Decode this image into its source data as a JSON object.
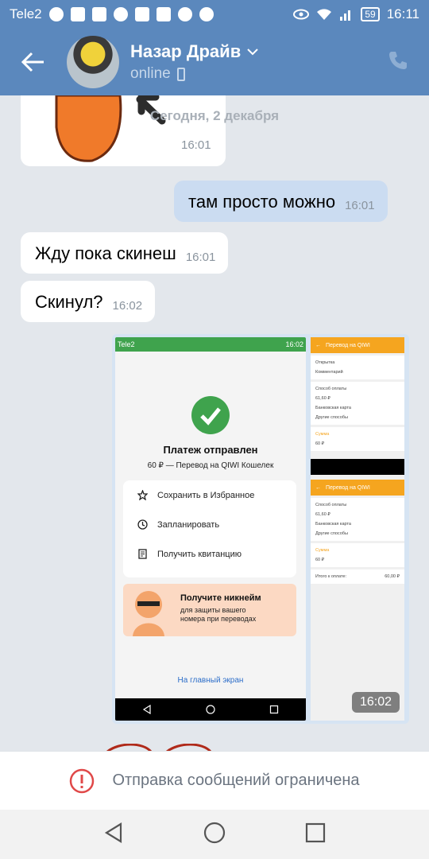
{
  "statusbar": {
    "carrier": "Tele2",
    "battery": "59",
    "time": "16:11"
  },
  "header": {
    "name": "Назар Драйв",
    "status": "online"
  },
  "chat": {
    "date_separator": "Сегодня, 2 декабря",
    "sticker_time": "16:01",
    "messages": [
      {
        "text": "там просто можно",
        "time": "16:01",
        "dir": "out"
      },
      {
        "text": "Жду пока скинеш",
        "time": "16:01",
        "dir": "in"
      },
      {
        "text": "Скинул?",
        "time": "16:02",
        "dir": "in"
      }
    ],
    "screenshot_time": "16:02"
  },
  "screenshot": {
    "status_carrier": "Tele2",
    "status_time": "16:02",
    "payment_title": "Платеж отправлен",
    "payment_subtitle": "60 ₽ — Перевод на QIWI Кошелек",
    "actions": [
      "Сохранить в Избранное",
      "Запланировать",
      "Получить квитанцию"
    ],
    "promo_title": "Получите никнейм",
    "promo_text": "для защиты вашего номера при переводах",
    "home_link": "На главный экран",
    "mini_header": "Перевод на QIWI",
    "mini_open": "Открытка",
    "mini_comment": "Комментарий",
    "mini_payment_method": "Способ оплаты",
    "mini_amount": "61,60 ₽",
    "mini_bank_card": "Банковская карта",
    "mini_other": "Другие способы",
    "mini_sum_label": "Сумма",
    "mini_sum": "60 ₽",
    "mini_total_label": "Итого к оплате:",
    "mini_total": "60,00 ₽"
  },
  "banner": {
    "text": "Отправка сообщений ограничена"
  },
  "colors": {
    "header": "#5b88bd",
    "bubble_out": "#cbdcf1",
    "background": "#e3e7ec",
    "qiwi_orange": "#f5a51f",
    "success_green": "#3fa34d"
  }
}
